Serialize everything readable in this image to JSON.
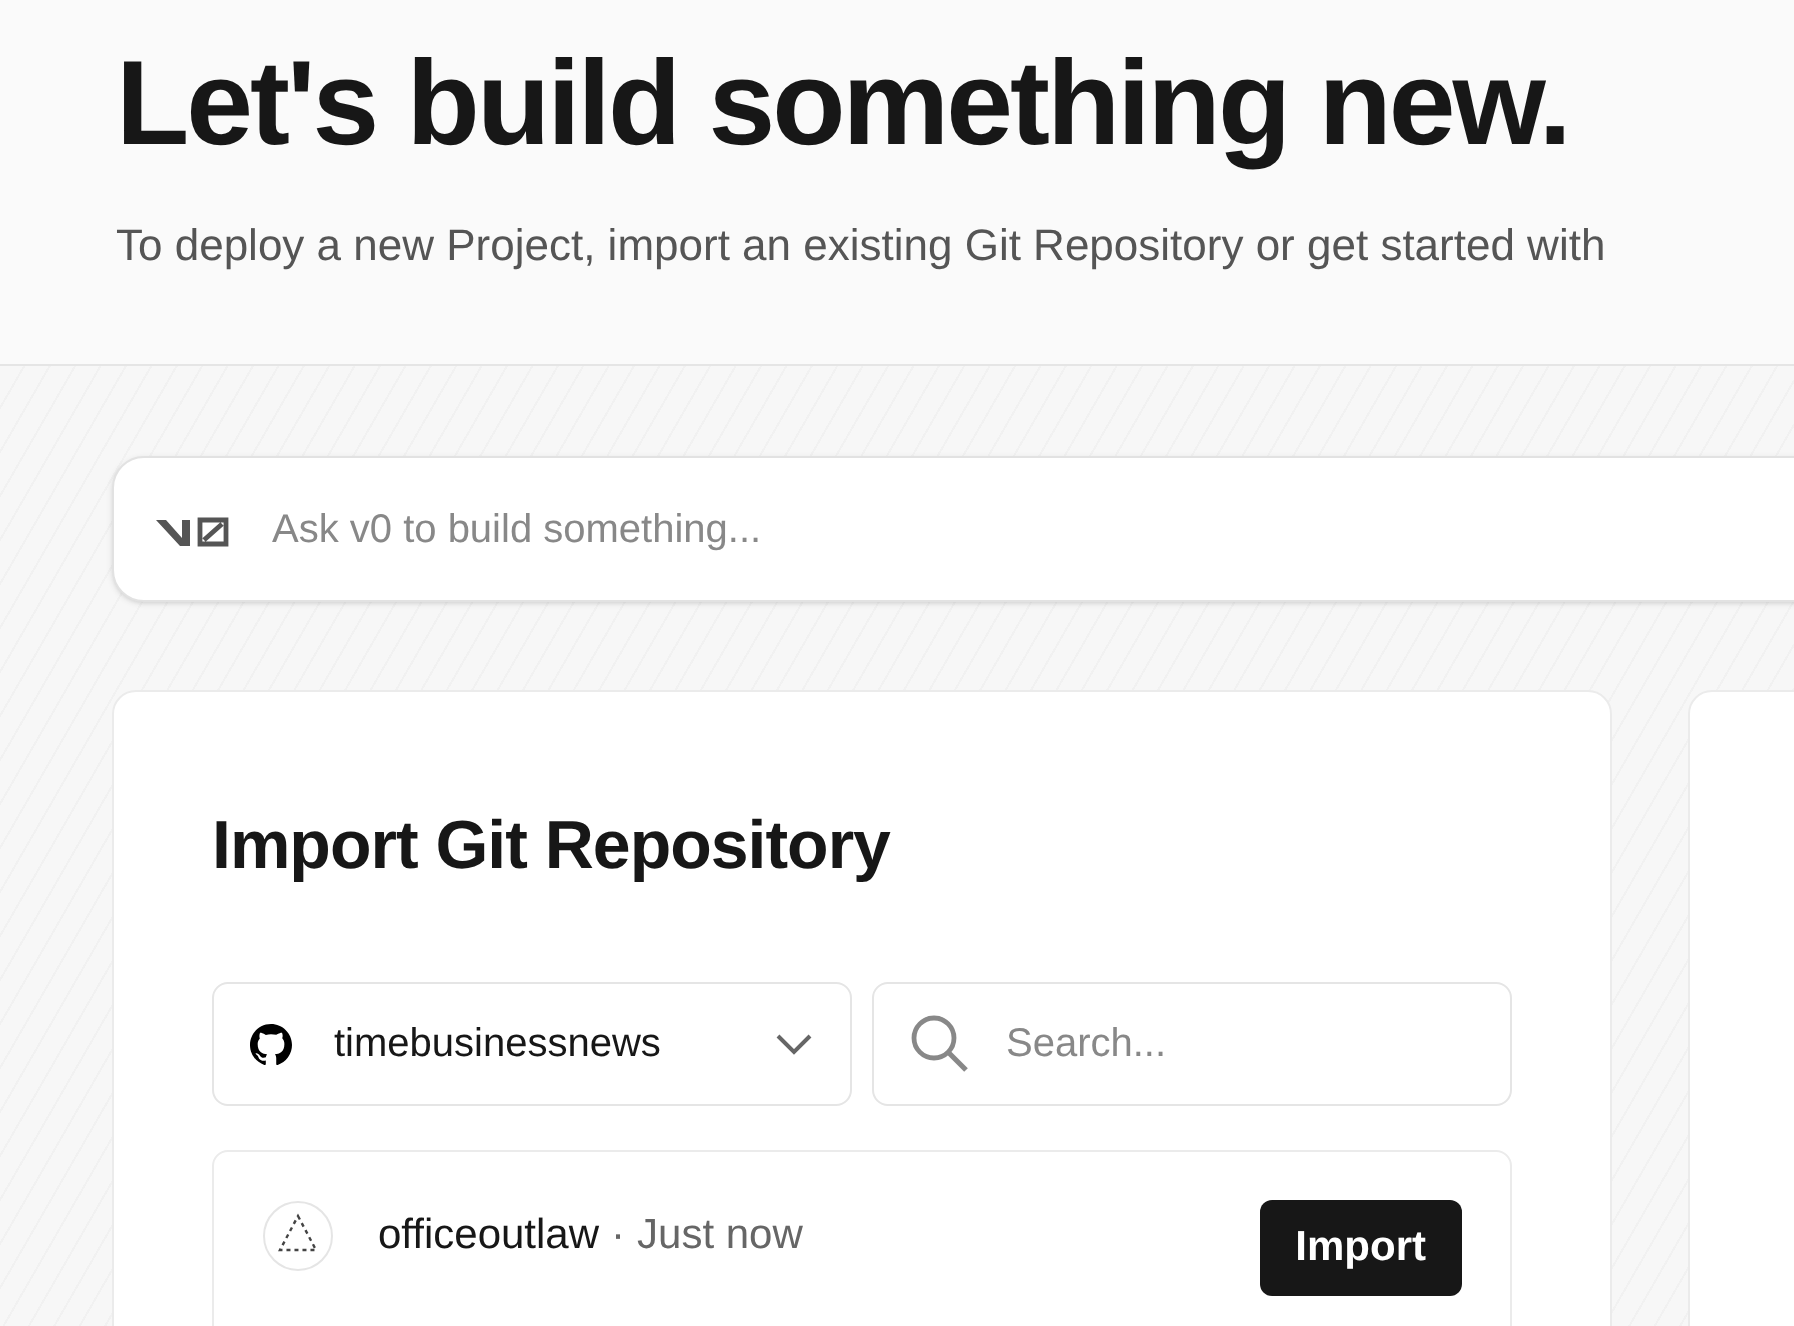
{
  "header": {
    "title": "Let's build something new.",
    "subtitle": "To deploy a new Project, import an existing Git Repository or get started with"
  },
  "prompt": {
    "placeholder": "Ask v0 to build something..."
  },
  "import_card": {
    "title": "Import Git Repository",
    "account_select": {
      "value": "timebusinessnews"
    },
    "search": {
      "placeholder": "Search..."
    },
    "repositories": [
      {
        "name": "officeoutlaw",
        "time": "Just now",
        "separator": "·",
        "action": "Import"
      }
    ]
  }
}
